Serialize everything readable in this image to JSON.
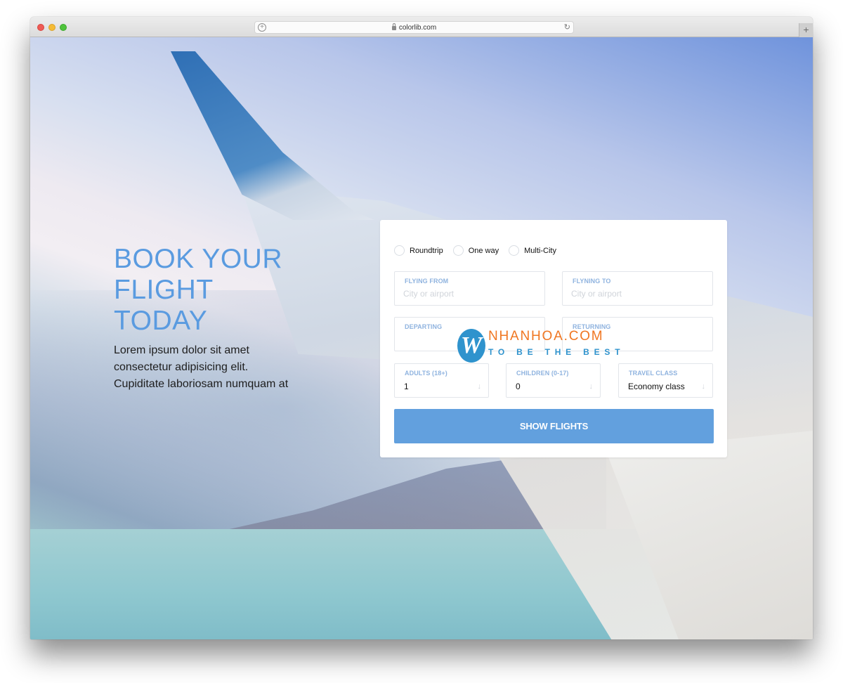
{
  "browser": {
    "url": "colorlib.com",
    "new_tab_label": "+",
    "url_add_label": "+",
    "reload_label": "↻"
  },
  "hero": {
    "title_lines": [
      "BOOK YOUR",
      "FLIGHT",
      "TODAY"
    ],
    "description_lines": [
      "Lorem ipsum dolor sit amet",
      "consectetur adipisicing elit.",
      "Cupiditate laboriosam numquam at"
    ]
  },
  "booking_form": {
    "trip_types": [
      {
        "label": "Roundtrip",
        "selected": false
      },
      {
        "label": "One way",
        "selected": false
      },
      {
        "label": "Multi-City",
        "selected": false
      }
    ],
    "flying_from": {
      "label": "FLYING FROM",
      "placeholder": "City or airport",
      "value": ""
    },
    "flying_to": {
      "label": "FLYNING TO",
      "placeholder": "City or airport",
      "value": ""
    },
    "departing": {
      "label": "DEPARTING",
      "value": ""
    },
    "returning": {
      "label": "RETURNING",
      "value": ""
    },
    "adults": {
      "label": "ADULTS (18+)",
      "value": "1",
      "arrow": "↓"
    },
    "children": {
      "label": "CHILDREN (0-17)",
      "value": "0",
      "arrow": "↓"
    },
    "travel_class": {
      "label": "TRAVEL CLASS",
      "value": "Economy class",
      "arrow": "↓"
    },
    "submit_label": "SHOW FLIGHTS"
  },
  "watermark": {
    "logo_letter": "W",
    "name": "NHANHOA.COM",
    "tagline": "TO BE THE BEST"
  },
  "colors": {
    "accent": "#62a0de",
    "heading": "#5a9be0",
    "field_label": "#8fb3df",
    "watermark_orange": "#f07621",
    "watermark_blue": "#2f93cd"
  }
}
